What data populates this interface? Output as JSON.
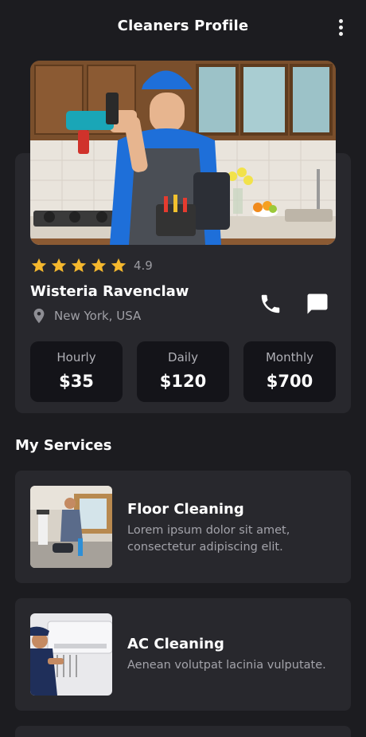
{
  "header": {
    "title": "Cleaners Profile",
    "menu_icon": "more-vertical-icon"
  },
  "profile": {
    "photo": "cleaner-portrait",
    "rating": 4.9,
    "rating_text": "4.9",
    "stars": 5,
    "name": "Wisteria Ravenclaw",
    "location": "New York, USA",
    "location_icon": "map-pin-icon",
    "call_icon": "phone-icon",
    "message_icon": "chat-icon"
  },
  "rates": [
    {
      "label": "Hourly",
      "value": "$35"
    },
    {
      "label": "Daily",
      "value": "$120"
    },
    {
      "label": "Monthly",
      "value": "$700"
    }
  ],
  "services": {
    "section_title": "My Services",
    "items": [
      {
        "title": "Floor Cleaning",
        "description": "Lorem ipsum dolor sit amet, consectetur adipiscing elit.",
        "image": "floor-cleaning-photo"
      },
      {
        "title": "AC Cleaning",
        "description": "Aenean volutpat lacinia vulputate.",
        "image": "ac-cleaning-photo"
      }
    ]
  },
  "colors": {
    "background": "#1c1c20",
    "card": "#28282d",
    "rate_box": "#141419",
    "star": "#f5b82e",
    "muted_text": "#a0a0a6"
  }
}
